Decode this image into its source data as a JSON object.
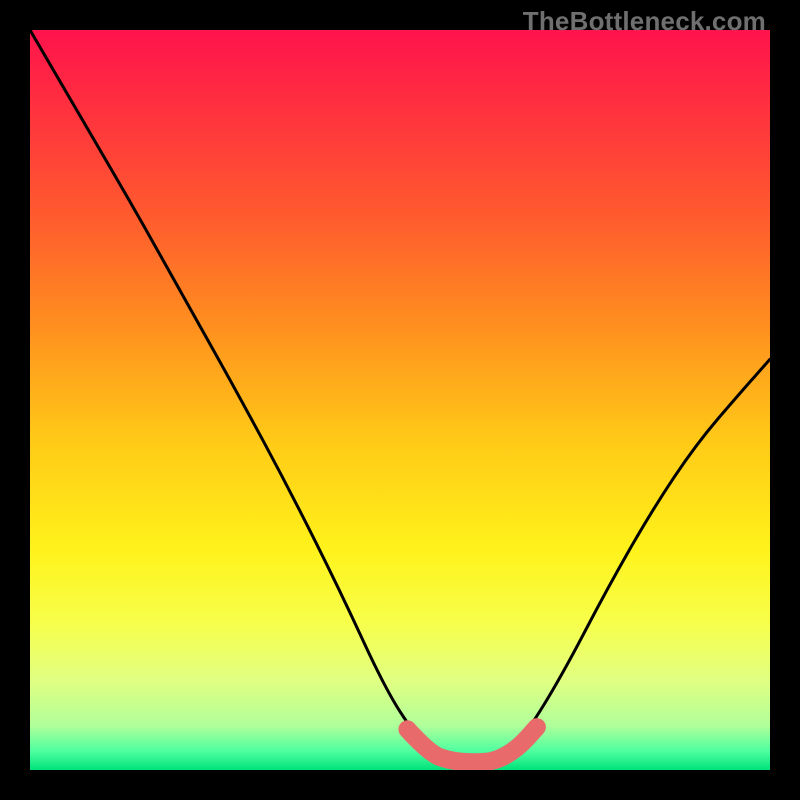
{
  "watermark": "TheBottleneck.com",
  "colors": {
    "frame": "#000000",
    "watermark_text": "#6f6f6f",
    "curve": "#000000",
    "marker": "#e86a6a",
    "gradient_stops": [
      {
        "offset": 0.0,
        "color": "#ff134c"
      },
      {
        "offset": 0.1,
        "color": "#ff2f3f"
      },
      {
        "offset": 0.25,
        "color": "#ff5a2e"
      },
      {
        "offset": 0.4,
        "color": "#ff8f1f"
      },
      {
        "offset": 0.55,
        "color": "#ffc817"
      },
      {
        "offset": 0.7,
        "color": "#fff21a"
      },
      {
        "offset": 0.8,
        "color": "#f7ff4a"
      },
      {
        "offset": 0.88,
        "color": "#e0ff82"
      },
      {
        "offset": 0.94,
        "color": "#b0ff9a"
      },
      {
        "offset": 0.975,
        "color": "#4dffa0"
      },
      {
        "offset": 1.0,
        "color": "#00e27a"
      }
    ]
  },
  "chart_data": {
    "type": "line",
    "title": "",
    "xlabel": "",
    "ylabel": "",
    "xlim": [
      0,
      1
    ],
    "ylim": [
      0,
      1
    ],
    "series": [
      {
        "name": "bottleneck-curve",
        "x": [
          0.0,
          0.07,
          0.14,
          0.21,
          0.28,
          0.35,
          0.42,
          0.48,
          0.52,
          0.555,
          0.6,
          0.635,
          0.67,
          0.72,
          0.78,
          0.84,
          0.9,
          0.96,
          1.0
        ],
        "y": [
          1.0,
          0.88,
          0.76,
          0.635,
          0.51,
          0.38,
          0.24,
          0.11,
          0.048,
          0.012,
          0.01,
          0.012,
          0.048,
          0.13,
          0.245,
          0.35,
          0.44,
          0.51,
          0.555
        ]
      }
    ],
    "marker_region": {
      "name": "optimal-range",
      "x": [
        0.51,
        0.54,
        0.57,
        0.6,
        0.63,
        0.66,
        0.685
      ],
      "y": [
        0.055,
        0.022,
        0.012,
        0.01,
        0.012,
        0.03,
        0.058
      ]
    }
  }
}
